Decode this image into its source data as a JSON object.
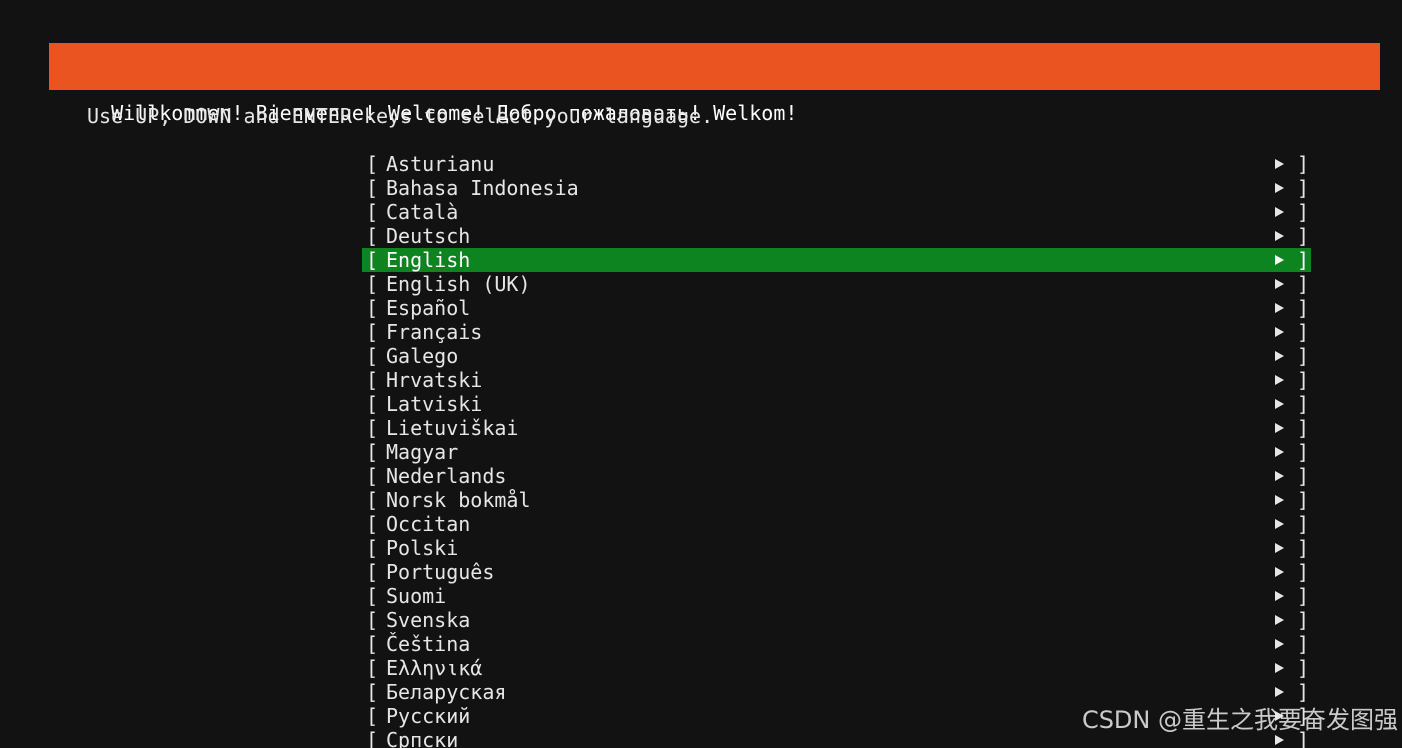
{
  "header": {
    "title": "Willkommen! Bienvenue! Welcome! Добро пожаловать! Welkom!"
  },
  "instructions": "Use UP, DOWN and ENTER keys to select your language.",
  "languages": {
    "open_bracket": "[",
    "close_bracket": "]",
    "arrow_icon": "right-triangle-icon",
    "selected": "English",
    "items": [
      {
        "label": "Asturianu"
      },
      {
        "label": "Bahasa Indonesia"
      },
      {
        "label": "Català"
      },
      {
        "label": "Deutsch"
      },
      {
        "label": "English"
      },
      {
        "label": "English (UK)"
      },
      {
        "label": "Español"
      },
      {
        "label": "Français"
      },
      {
        "label": "Galego"
      },
      {
        "label": "Hrvatski"
      },
      {
        "label": "Latviski"
      },
      {
        "label": "Lietuviškai"
      },
      {
        "label": "Magyar"
      },
      {
        "label": "Nederlands"
      },
      {
        "label": "Norsk bokmål"
      },
      {
        "label": "Occitan"
      },
      {
        "label": "Polski"
      },
      {
        "label": "Português"
      },
      {
        "label": "Suomi"
      },
      {
        "label": "Svenska"
      },
      {
        "label": "Čeština"
      },
      {
        "label": "Ελληνικά"
      },
      {
        "label": "Беларуская"
      },
      {
        "label": "Русский"
      },
      {
        "label": "Српски"
      }
    ]
  },
  "colors": {
    "background": "#121212",
    "header": "#e95420",
    "selected": "#0e8420",
    "text": "#e6e6e6"
  },
  "watermark": "CSDN @重生之我要奋发图强"
}
